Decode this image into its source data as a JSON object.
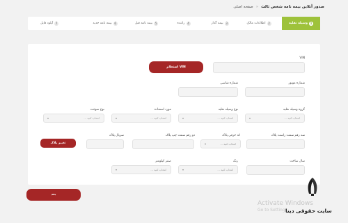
{
  "breadcrumb": {
    "home": "صفحه اصلی",
    "separator": "«",
    "current": "صدور آنلاین بیمه نامه شخص ثالث"
  },
  "steps": [
    {
      "num": "1",
      "label": "وسیله نقلیه",
      "active": true
    },
    {
      "num": "2",
      "label": "اطلاعات مالک",
      "active": false
    },
    {
      "num": "3",
      "label": "بیمه گذار",
      "active": false
    },
    {
      "num": "4",
      "label": "راننده",
      "active": false
    },
    {
      "num": "5",
      "label": "بیمه نامه قبل",
      "active": false
    },
    {
      "num": "6",
      "label": "بیمه نامه جدید",
      "active": false
    },
    {
      "num": "7",
      "label": "آپلود فایل",
      "active": false
    }
  ],
  "form": {
    "vin_label": "VIN",
    "vin_button": "استعلام VIN",
    "engine_label": "شماره موتور",
    "chassis_label": "شماره شاسی",
    "vehicle_group_label": "گروه وسیله نقلیه",
    "vehicle_type_label": "نوع وسیله نقلیه",
    "usage_label": "مورد استفاده",
    "fuel_label": "نوع سوخت",
    "plate_right_label": "سه رقم سمت راست پلاک",
    "plate_letter_label": "کد حرفی پلاک",
    "plate_left_label": "دو رقم سمت چپ پلاک",
    "plate_serial_label": "سریال پلاک",
    "change_plate_button": "تغییر پلاک",
    "year_label": "سال ساخت",
    "color_label": "رنگ",
    "odometer_label": "صفر کیلومتر",
    "select_placeholder": "انتخاب کنید ..."
  },
  "next_button": "بعد",
  "watermark": {
    "line1": "Activate Windows",
    "line2": "Go to Settings"
  },
  "site_logo_text": "سایت حقوقی دینا",
  "colors": {
    "accent_green": "#9ec23b",
    "button_red": "#a52626",
    "background": "#f2f2f2"
  }
}
